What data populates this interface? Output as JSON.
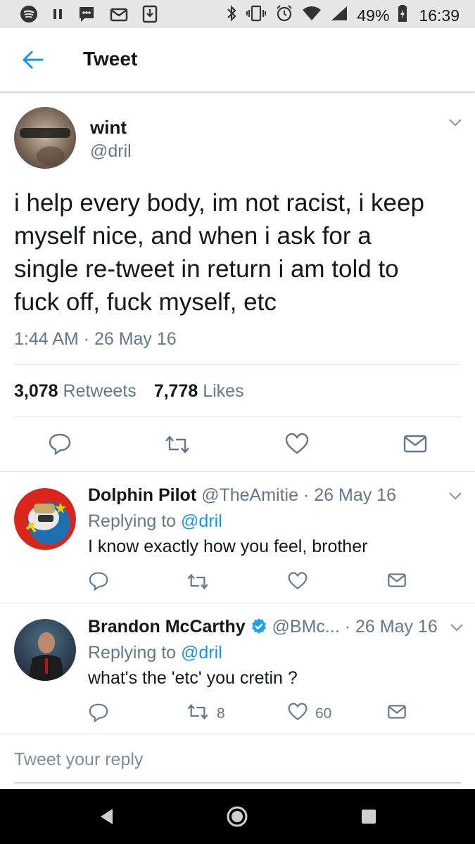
{
  "status_bar": {
    "battery": "49%",
    "time": "16:39",
    "left_icons": [
      "spotify-icon",
      "pause-icon",
      "chat-icon",
      "mail-icon",
      "download-icon"
    ],
    "right_icons": [
      "bluetooth-icon",
      "vibrate-icon",
      "alarm-icon",
      "wifi-icon",
      "signal-icon",
      "battery-icon"
    ]
  },
  "header": {
    "title": "Tweet"
  },
  "tweet": {
    "display_name": "wint",
    "handle": "@dril",
    "text_lines": [
      "i help every body, im not racist, i keep",
      "myself nice, and when i ask for a",
      "single re-tweet in return i am told to",
      "fuck off, fuck myself, etc"
    ],
    "timestamp": "1:44 AM · 26 May 16",
    "retweet_count": "3,078",
    "retweet_label": "Retweets",
    "like_count": "7,778",
    "like_label": "Likes"
  },
  "replies": [
    {
      "display_name": "Dolphin Pilot",
      "handle": "@TheAmitie",
      "date": "· 26 May 16",
      "replying_prefix": "Replying to",
      "replying_handle": "@dril",
      "text": "I know exactly how you feel, brother",
      "retweets": "",
      "likes": ""
    },
    {
      "display_name": "Brandon McCarthy",
      "handle": "@BMc...",
      "date": "· 26 May 16",
      "replying_prefix": "Replying to",
      "replying_handle": "@dril",
      "text": "what's the 'etc' you cretin ?",
      "retweets": "8",
      "likes": "60"
    }
  ],
  "compose": {
    "placeholder": "Tweet your reply"
  },
  "colors": {
    "accent": "#1b95e0",
    "muted": "#657786",
    "text": "#14171a",
    "divider": "#e1e8ed",
    "verified": "#1da1f2"
  }
}
